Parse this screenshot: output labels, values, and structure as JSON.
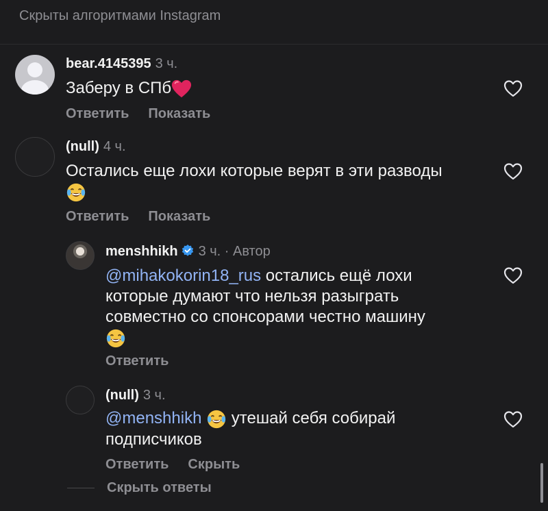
{
  "header": {
    "hidden_label": "Скрыты алгоритмами Instagram"
  },
  "comments": [
    {
      "username": "bear.4145395",
      "time": "3 ч.",
      "text": "Заберу в СПб",
      "actions": [
        "Ответить",
        "Показать"
      ]
    },
    {
      "username": "(null)",
      "time": "4 ч.",
      "text": "Остались еще лохи которые верят в эти разводы",
      "actions": [
        "Ответить",
        "Показать"
      ]
    }
  ],
  "replies": [
    {
      "username": "menshhikh",
      "time": "3 ч.",
      "author_label": "· Автор",
      "mention": "@mihakokorin18_rus",
      "text": " остались ещё лохи которые думают что нельзя разыграть совместно со спонсорами честно машину",
      "actions": [
        "Ответить"
      ]
    },
    {
      "username": "(null)",
      "time": "3 ч.",
      "mention": "@menshhikh",
      "text": " утешай себя собирай подписчиков",
      "actions": [
        "Ответить",
        "Скрыть"
      ]
    }
  ],
  "footer": {
    "hide_replies": "Скрыть ответы"
  },
  "colors": {
    "background": "#1c1c1e",
    "mention": "#92b4f5",
    "secondary": "#8e8e93",
    "verified": "#3897f0",
    "heart_emoji": "#e0245e"
  }
}
